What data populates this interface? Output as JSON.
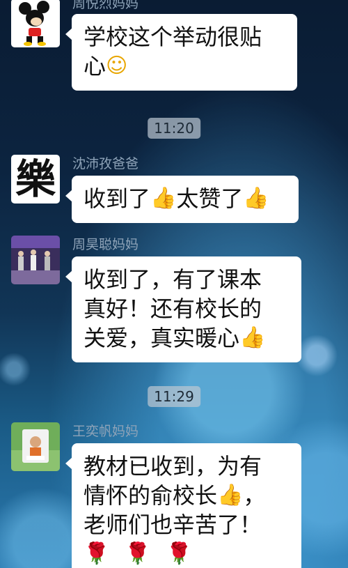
{
  "messages": [
    {
      "sender": "周悦烈妈妈",
      "avatar_icon": "mickey-mouse-avatar",
      "lines": [
        "学校这个举动很贴",
        "心"
      ],
      "emoji": "☺"
    },
    {
      "sender": "沈沛孜爸爸",
      "avatar_icon": "yue-character-avatar",
      "avatar_text": "樂",
      "lines": [
        "收到了",
        "太赞了"
      ],
      "emoji": [
        "👍",
        "👍"
      ]
    },
    {
      "sender": "周昊聪妈妈",
      "avatar_icon": "dance-photo-avatar",
      "lines": [
        "收到了，有了课本",
        "真好！还有校长的",
        "关爱，真实暖心"
      ],
      "emoji": "👍"
    },
    {
      "sender": "王奕帆妈妈",
      "avatar_icon": "child-photo-avatar",
      "lines": [
        "教材已收到，为有",
        "情怀的俞校长",
        "，",
        "老师们也辛苦了！"
      ],
      "emoji": [
        "👍",
        "🌹"
      ]
    }
  ],
  "timestamps": [
    "11:20",
    "11:29"
  ]
}
